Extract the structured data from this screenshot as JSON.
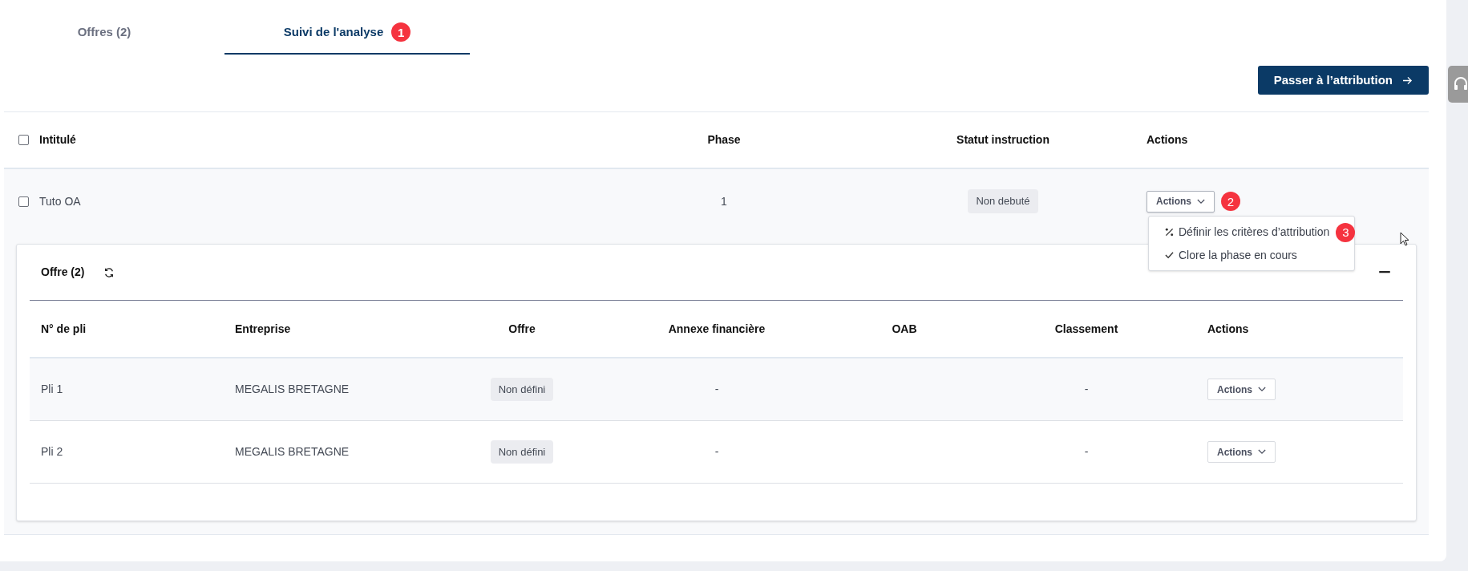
{
  "tabs": [
    {
      "label": "Offres (2)",
      "selected": false
    },
    {
      "label": "Suivi de l'analyse",
      "selected": true,
      "marker": "1"
    }
  ],
  "primary_button": {
    "label": "Passer à l’attribution"
  },
  "table": {
    "select_all_checked": false,
    "columns": [
      "Intitulé",
      "Phase",
      "Statut instruction",
      "Actions"
    ],
    "rows": [
      {
        "checked": false,
        "title": "Tuto OA",
        "phase": "1",
        "status": "Non debuté",
        "actions": {
          "label": "Actions",
          "expanded": true,
          "marker": "2",
          "menu": [
            {
              "kind": "percent",
              "label": "Définir les critères d’attribution",
              "marker": "3"
            },
            {
              "kind": "check",
              "label": "Clore la phase en cours"
            }
          ]
        },
        "detail": {
          "title": "Offre (2)",
          "columns": [
            "N° de pli",
            "Entreprise",
            "Offre",
            "Annexe financière",
            "OAB",
            "Classement",
            "Actions"
          ],
          "rows": [
            {
              "pli": "Pli 1",
              "entreprise": "MEGALIS BRETAGNE",
              "offre": "Non défini",
              "annexe": "-",
              "classement": "-",
              "actions": "Actions"
            },
            {
              "pli": "Pli 2",
              "entreprise": "MEGALIS BRETAGNE",
              "offre": "Non défini",
              "annexe": "-",
              "classement": "-",
              "actions": "Actions"
            }
          ]
        }
      }
    ]
  }
}
